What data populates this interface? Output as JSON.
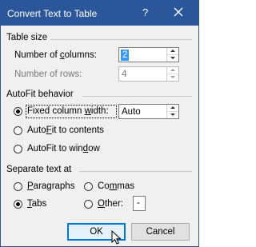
{
  "window": {
    "title": "Convert Text to Table",
    "help": "?",
    "close_icon": "close-icon"
  },
  "table_size": {
    "heading": "Table size",
    "columns_label_pre": "Number of ",
    "columns_label_u": "c",
    "columns_label_post": "olumns:",
    "columns_value": "2",
    "rows_label": "Number of rows:",
    "rows_value": "4"
  },
  "autofit": {
    "heading": "AutoFit behavior",
    "fixed_pre": "Fixed column ",
    "fixed_u": "w",
    "fixed_post": "idth:",
    "fixed_value": "Auto",
    "contents_pre": "Auto",
    "contents_u": "F",
    "contents_post": "it to contents",
    "window_pre": "AutoFit to win",
    "window_u": "d",
    "window_post": "ow",
    "selected": "fixed"
  },
  "separate": {
    "heading": "Separate text at",
    "paragraphs_u": "P",
    "paragraphs_post": "aragraphs",
    "commas_pre": "Co",
    "commas_u": "m",
    "commas_post": "mas",
    "tabs_u": "T",
    "tabs_post": "abs",
    "other_u": "O",
    "other_post": "ther:",
    "other_value": "-",
    "selected": "tabs"
  },
  "buttons": {
    "ok": "OK",
    "cancel": "Cancel"
  },
  "colors": {
    "titlebar": "#2b579a",
    "default_button_border": "#0078d7",
    "selection": "#3399ff"
  }
}
